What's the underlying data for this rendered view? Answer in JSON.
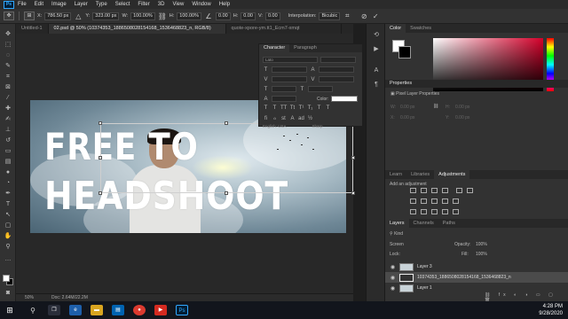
{
  "app": {
    "logo": "Ps"
  },
  "menu": [
    "File",
    "Edit",
    "Image",
    "Layer",
    "Type",
    "Select",
    "Filter",
    "3D",
    "View",
    "Window",
    "Help"
  ],
  "options": {
    "x_label": "X:",
    "x_value": "786.50 px",
    "y_label": "Y:",
    "y_value": "323.00 px",
    "w_label": "W:",
    "w_value": "100.00%",
    "h_label": "H:",
    "h_value": "100.00%",
    "angle_value": "0.00",
    "h_skew_label": "H:",
    "h_skew_value": "0.00",
    "v_label": "V:",
    "v_value": "0.00",
    "interp_label": "Interpolation:",
    "interp_value": "Bicubic"
  },
  "doc_tabs": [
    {
      "label": "Untitled-1"
    },
    {
      "label": "02.psd @ 50% (10374353_1886508028154168_1536468823_n, RGB/8)"
    },
    {
      "label": "quote-xpore-ym.tt1_Ecm7-xmqt"
    }
  ],
  "artwork": {
    "line1": "FREE TO",
    "line2": "HEADSHOOT"
  },
  "status": {
    "zoom": "50%",
    "doc": "Doc: 2.64M/22.2M"
  },
  "character_panel": {
    "tabs": [
      "Character",
      "Paragraph"
    ],
    "color_label": "Color:",
    "font_family": "Lato",
    "language": "English: USA",
    "aa": "Sharp"
  },
  "color_panel": {
    "tabs": [
      "Color",
      "Swatches"
    ]
  },
  "properties": {
    "title": "Properties",
    "subtitle": "Pixel Layer Properties",
    "w": "W:",
    "h": "H:",
    "w_val": "0.00 px",
    "h_val": "0.00 px",
    "x": "X:",
    "y": "Y:",
    "x_val": "0.00 px",
    "y_val": "0.00 px"
  },
  "adjustments": {
    "tabs": [
      "Learn",
      "Libraries",
      "Adjustments"
    ],
    "hint": "Add an adjustment"
  },
  "layers": {
    "tabs": [
      "Layers",
      "Channels",
      "Paths"
    ],
    "kind_label": "Kind",
    "blend_mode": "Screen",
    "opacity_label": "Opacity:",
    "opacity_value": "100%",
    "lock_label": "Lock:",
    "fill_label": "Fill:",
    "fill_value": "100%",
    "items": [
      {
        "name": "Layer 3"
      },
      {
        "name": "10374353_1886508028154168_1536468823_n"
      },
      {
        "name": "Layer 1"
      }
    ]
  },
  "taskbar": {
    "time": "4:28 PM",
    "date": "9/28/2020"
  }
}
